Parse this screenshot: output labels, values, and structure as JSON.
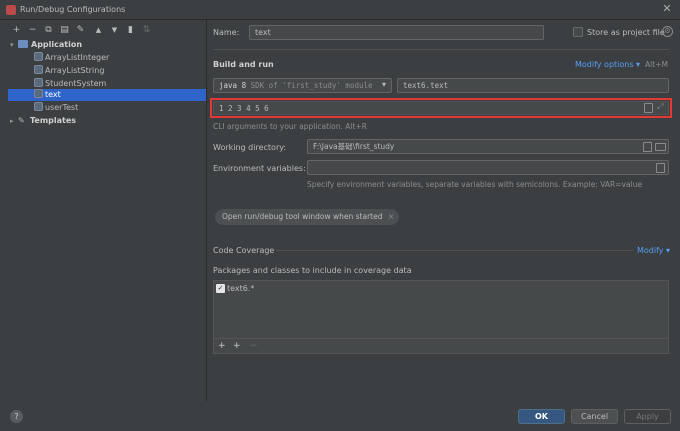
{
  "window": {
    "title": "Run/Debug Configurations"
  },
  "toolbar": {
    "add": "+",
    "remove": "−",
    "copy": "⧉",
    "save": "▤",
    "wrench": "✎",
    "up": "▲",
    "down": "▼",
    "folder": "▮",
    "sort": "⇅"
  },
  "tree": {
    "application": "Application",
    "items": [
      "ArrayListInteger",
      "ArrayListString",
      "StudentSystem",
      "text",
      "userTest"
    ],
    "templates": "Templates"
  },
  "form": {
    "name_label": "Name:",
    "name_value": "text",
    "store_label": "Store as project file",
    "build_run": "Build and run",
    "modify_options": "Modify options",
    "modify_shortcut": "Alt+M",
    "jdk_value": "java 8",
    "jdk_hint": "SDK of 'first_study' module",
    "main_class": "text6.text",
    "program_args": "1 2 3 4 5 6",
    "cli_hint": "CLI arguments to your application. Alt+R",
    "workdir_label": "Working directory:",
    "workdir_value": "F:\\Java基础\\first_study",
    "env_label": "Environment variables:",
    "env_hint": "Specify environment variables, separate variables with semicolons. Example: VAR=value",
    "chip": "Open run/debug tool window when started",
    "coverage_title": "Code Coverage",
    "coverage_modify": "Modify",
    "packages_label": "Packages and classes to include in coverage data",
    "package_item": "text6.*"
  },
  "buttons": {
    "ok": "OK",
    "cancel": "Cancel",
    "apply": "Apply",
    "help": "?"
  },
  "colors": {
    "selection": "#2f65ca",
    "highlight_border": "#e53935",
    "link": "#589df6",
    "primary_button": "#365880"
  }
}
